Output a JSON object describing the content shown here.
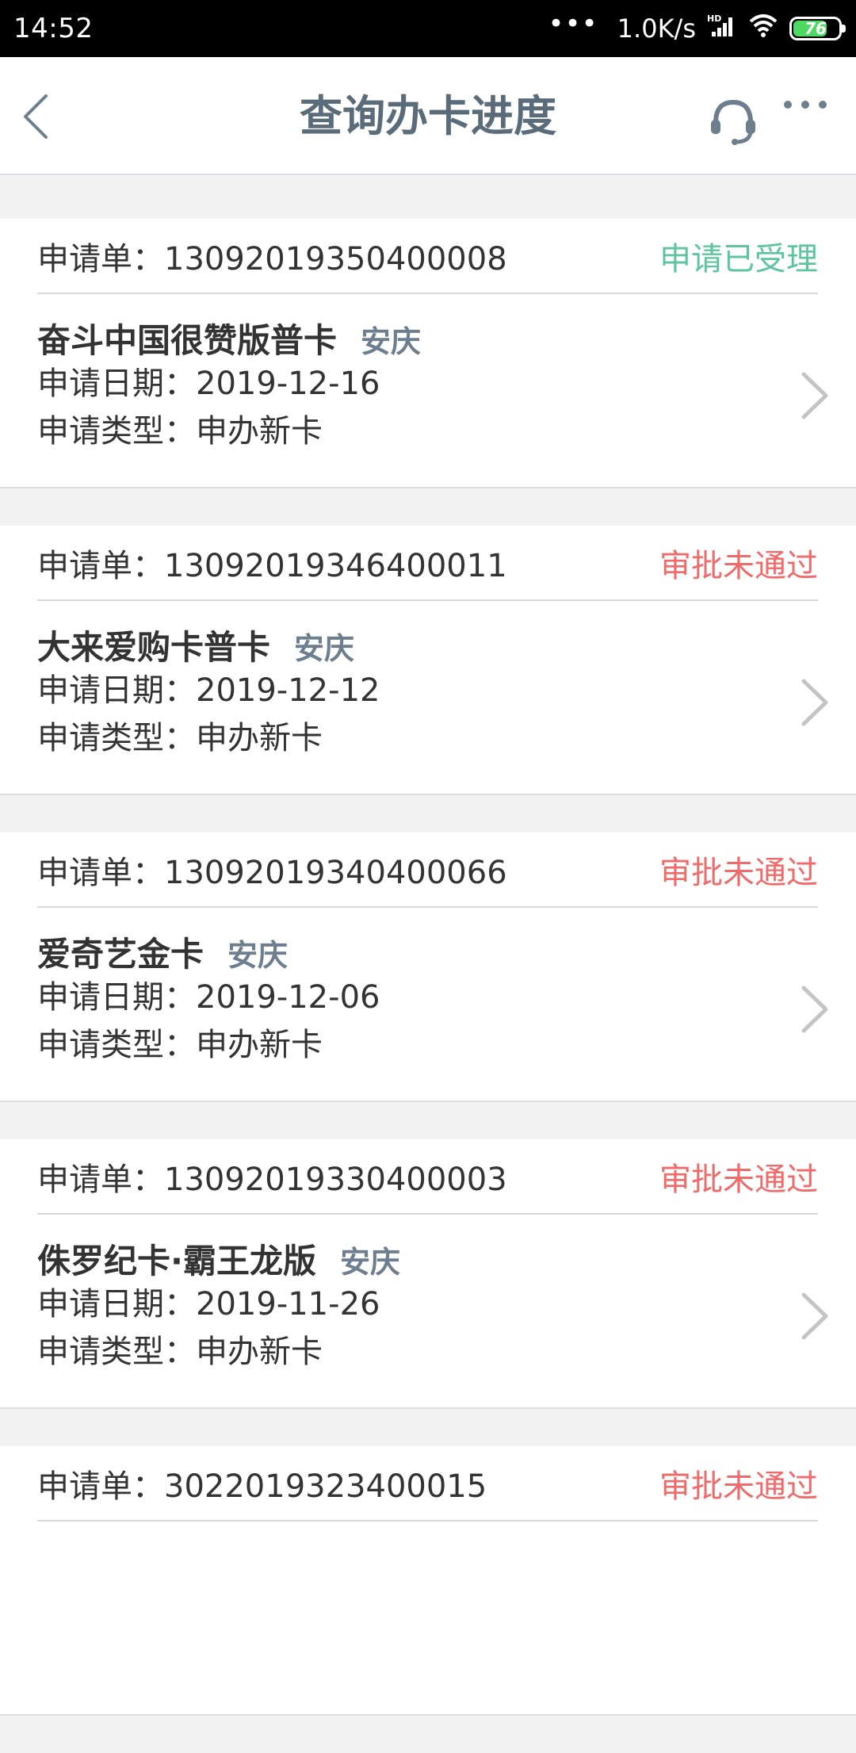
{
  "status_bar": {
    "time": "14:52",
    "dots": "•••",
    "net_speed": "1.0K/s",
    "battery_level": "76",
    "battery_fraction": 0.76
  },
  "nav": {
    "title": "查询办卡进度",
    "back_icon": "chevron-left-icon",
    "service_icon": "headset-icon",
    "more_icon": "more-dots-icon"
  },
  "colors": {
    "accepted": "#5cc59e",
    "rejected": "#f06a6a",
    "city": "#6d7f8e",
    "title": "#5a6b7a"
  },
  "applications": [
    {
      "no_label": "申请单：",
      "no": "13092019350400008",
      "status": "申请已受理",
      "status_type": "ok",
      "card_name": "奋斗中国很赞版普卡",
      "city": "安庆",
      "date_label": "申请日期：",
      "date": "2019-12-16",
      "type_label": "申请类型：",
      "type": "申办新卡"
    },
    {
      "no_label": "申请单：",
      "no": "13092019346400011",
      "status": "审批未通过",
      "status_type": "fail",
      "card_name": "大来爱购卡普卡",
      "city": "安庆",
      "date_label": "申请日期：",
      "date": "2019-12-12",
      "type_label": "申请类型：",
      "type": "申办新卡"
    },
    {
      "no_label": "申请单：",
      "no": "13092019340400066",
      "status": "审批未通过",
      "status_type": "fail",
      "card_name": "爱奇艺金卡",
      "city": "安庆",
      "date_label": "申请日期：",
      "date": "2019-12-06",
      "type_label": "申请类型：",
      "type": "申办新卡"
    },
    {
      "no_label": "申请单：",
      "no": "13092019330400003",
      "status": "审批未通过",
      "status_type": "fail",
      "card_name": "侏罗纪卡·霸王龙版",
      "city": "安庆",
      "date_label": "申请日期：",
      "date": "2019-11-26",
      "type_label": "申请类型：",
      "type": "申办新卡"
    },
    {
      "no_label": "申请单：",
      "no": "3022019323400015",
      "status": "审批未通过",
      "status_type": "fail",
      "card_name": "",
      "city": "",
      "date_label": "",
      "date": "",
      "type_label": "",
      "type": ""
    }
  ]
}
